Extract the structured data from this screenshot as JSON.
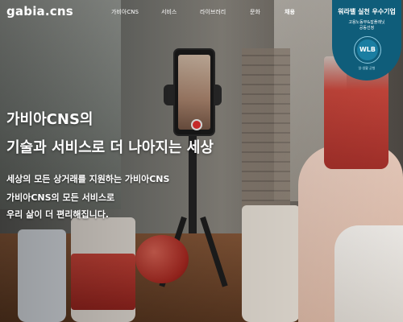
{
  "header": {
    "logo_text": "gabia.cns",
    "nav": [
      "가비아CNS",
      "서비스",
      "라이브러리",
      "문화",
      "채용"
    ]
  },
  "badge": {
    "title": "워라밸 실천 우수기업",
    "subtitle_line1": "고용노동부&잡플래닛",
    "subtitle_line2": "공동선정",
    "emblem_text": "WLB",
    "emblem_caption": "일·생활 균형"
  },
  "hero": {
    "title_line1": "가비아CNS의",
    "title_line2": "기술과 서비스로 더 나아지는 세상",
    "desc_line1": "세상의 모든 상거래를 지원하는 가비아CNS",
    "desc_line2": "가비아CNS의 모든 서비스로",
    "desc_line3": "우리 삶이 더 편리해집니다."
  },
  "colors": {
    "badge_bg": "#0f5d7a",
    "text": "#ffffff"
  }
}
